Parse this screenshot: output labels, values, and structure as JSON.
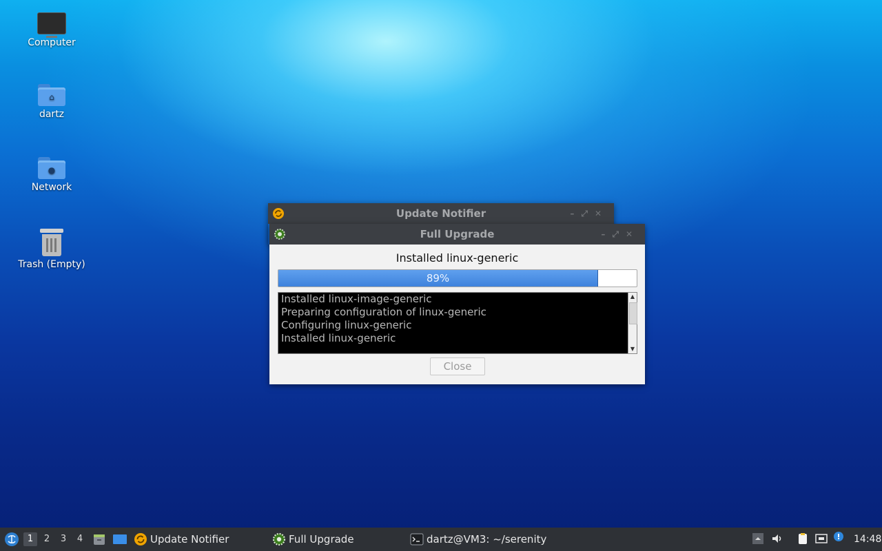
{
  "desktop": {
    "icons": [
      {
        "label": "Computer",
        "icon": "computer-icon"
      },
      {
        "label": "dartz",
        "icon": "home-folder-icon"
      },
      {
        "label": "Network",
        "icon": "network-folder-icon"
      },
      {
        "label": "Trash (Empty)",
        "icon": "trash-icon"
      }
    ]
  },
  "windows": {
    "update_notifier": {
      "title": "Update Notifier",
      "icon": "update-notifier-icon"
    },
    "full_upgrade": {
      "title": "Full Upgrade",
      "icon": "gear-icon",
      "status_text": "Installed linux-generic",
      "progress": {
        "percent": 89,
        "label": "89%"
      },
      "log_lines": [
        "Installed linux-image-generic",
        "Preparing configuration of linux-generic",
        "Configuring linux-generic",
        "Installed linux-generic"
      ],
      "close_label": "Close"
    }
  },
  "taskbar": {
    "workspaces": [
      "1",
      "2",
      "3",
      "4"
    ],
    "active_workspace": "1",
    "tasks": [
      {
        "label": "Update Notifier",
        "icon": "update-notifier-icon"
      },
      {
        "label": "Full Upgrade",
        "icon": "gear-icon"
      },
      {
        "label": "dartz@VM3: ~/serenity",
        "icon": "terminal-icon"
      }
    ],
    "clock": "14:48"
  },
  "colors": {
    "taskbar_bg": "#2e3136",
    "titlebar_bg": "#3c3f44",
    "progress_fill": "#3e82dc",
    "accent_orange": "#f0a400"
  }
}
